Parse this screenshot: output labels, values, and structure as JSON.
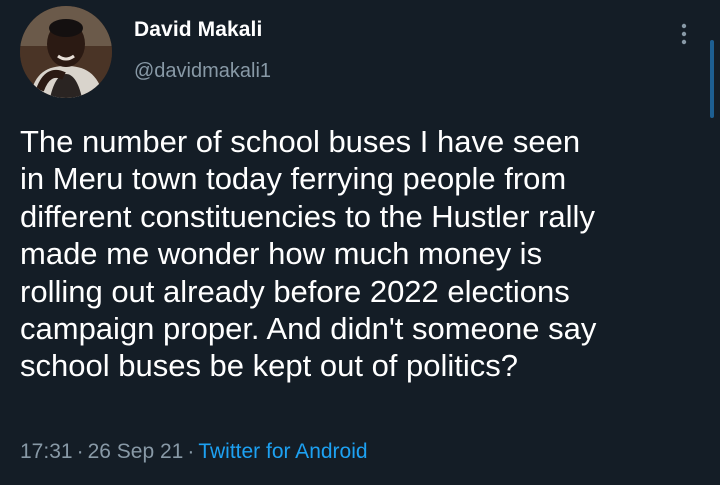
{
  "tweet": {
    "author": {
      "name": "David Makali",
      "handle": "@davidmakali1",
      "avatar_icon": "profile-photo"
    },
    "menu_icon": "more-vertical-icon",
    "text": "The number of school buses I have seen\nin Meru town today ferrying people from\ndifferent constituencies to the Hustler rally\nmade me wonder how much money is\nrolling out already before 2022 elections\ncampaign proper. And didn't someone say\nschool buses be kept out of politics?",
    "time": "17:31",
    "separator": "·",
    "date": "26 Sep 21",
    "source": "Twitter for Android"
  },
  "colors": {
    "background": "#141d26",
    "text_primary": "#ffffff",
    "text_secondary": "#8899a6",
    "link": "#1da1f2"
  }
}
